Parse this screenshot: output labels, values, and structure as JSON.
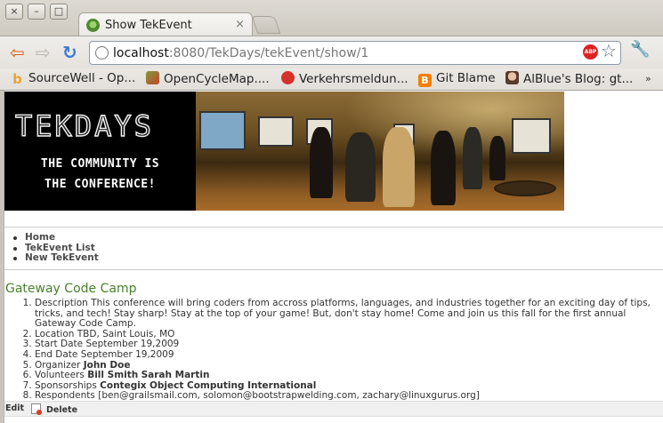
{
  "window": {
    "close_glyph": "×",
    "minimize_glyph": "–",
    "maximize_glyph": "□"
  },
  "tab": {
    "title": "Show TekEvent",
    "close_glyph": "×"
  },
  "toolbar": {
    "back_glyph": "⇦",
    "forward_glyph": "⇨",
    "reload_glyph": "↻",
    "url_host": "localhost",
    "url_path": ":8080/TekDays/tekEvent/show/1",
    "adblock_label": "ABP",
    "star_glyph": "☆",
    "wrench_glyph": "🔧"
  },
  "bookmarks": [
    {
      "label": "SourceWell - Op...",
      "icon": "sourcewell-icon",
      "color": "#e8a33a",
      "glyph": "b"
    },
    {
      "label": "OpenCycleMap....",
      "icon": "opencyclemap-icon",
      "color": "#7a9b3c",
      "glyph": ""
    },
    {
      "label": "Verkehrsmeldun...",
      "icon": "verkehr-icon",
      "color": "#d6312b",
      "glyph": ""
    },
    {
      "label": "Git Blame",
      "icon": "blogger-icon",
      "color": "#f57d00",
      "glyph": "B"
    },
    {
      "label": "AlBlue's Blog: gt...",
      "icon": "avatar-icon",
      "color": "#c79a7a",
      "glyph": ""
    }
  ],
  "bookmarks_more": "»",
  "banner": {
    "logo": "TEKDAYS",
    "tagline_line1": "THE COMMUNITY IS",
    "tagline_line2": "THE CONFERENCE!"
  },
  "nav": {
    "home": "Home",
    "list": "TekEvent List",
    "create": "New TekEvent"
  },
  "event": {
    "name": "Gateway Code Camp",
    "description_label": "Description",
    "description": "This conference will bring coders from accross platforms, languages, and industries together for an exciting day of tips, tricks, and tech! Stay sharp! Stay at the top of your game! But, don't stay home! Come and join us this fall for the first annual Gateway Code Camp.",
    "location_label": "Location",
    "location": "TBD, Saint Louis, MO",
    "start_label": "Start Date",
    "start": "September 19,2009",
    "end_label": "End Date",
    "end": "September 19,2009",
    "organizer_label": "Organizer",
    "organizer": "John Doe",
    "volunteers_label": "Volunteers",
    "volunteers": [
      "Bill Smith",
      "Sarah Martin"
    ],
    "sponsorships_label": "Sponsorships",
    "sponsorships": [
      "Contegix",
      "Object Computing International"
    ],
    "respondents_label": "Respondents",
    "respondents": "[ben@grailsmail.com, solomon@bootstrapwelding.com, zachary@linuxgurus.org]"
  },
  "actions": {
    "edit": "Edit",
    "delete": "Delete"
  }
}
